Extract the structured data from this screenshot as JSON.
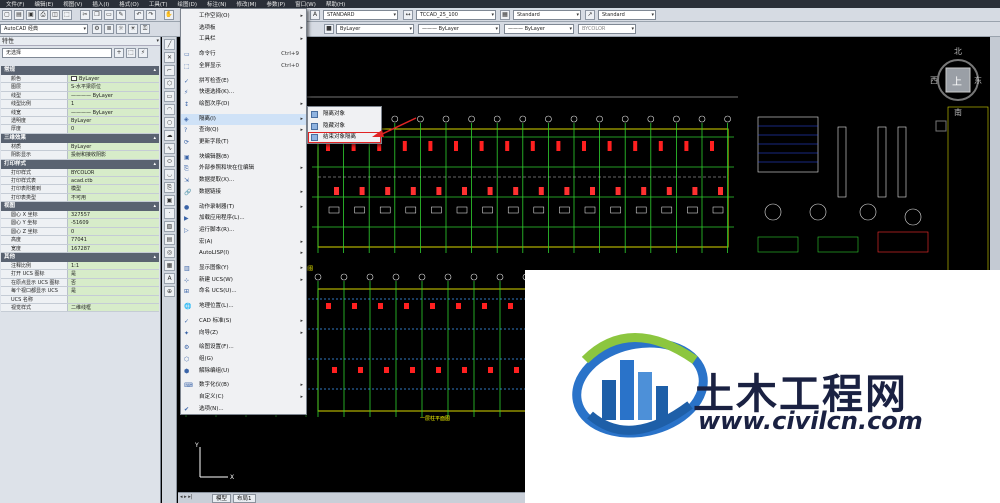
{
  "menubar": [
    "文件(F)",
    "编辑(E)",
    "视图(V)",
    "插入(I)",
    "格式(O)",
    "工具(T)",
    "绘图(D)",
    "标注(N)",
    "修改(M)",
    "参数(P)",
    "窗口(W)",
    "帮助(H)"
  ],
  "toolbar": {
    "workspace": "AutoCAD 经典",
    "text_style": "STANDARD",
    "dim_style": "TCCAD_25_100",
    "table_style": "Standard",
    "mleader_style": "Standard",
    "layer_color": "ByLayer",
    "linetype": "ByLayer",
    "lineweight": "ByLayer",
    "plot_style": "BYCOLOR"
  },
  "properties": {
    "title": "特性",
    "selection": "无选择",
    "sections": [
      {
        "name": "常规",
        "rows": [
          {
            "k": "颜色",
            "v": "ByLayer",
            "swatch": true
          },
          {
            "k": "图层",
            "v": "S-水平梁原位"
          },
          {
            "k": "线型",
            "v": "———— ByLayer"
          },
          {
            "k": "线型比例",
            "v": "1"
          },
          {
            "k": "线宽",
            "v": "———— ByLayer"
          },
          {
            "k": "透明度",
            "v": "ByLayer"
          },
          {
            "k": "厚度",
            "v": "0"
          }
        ]
      },
      {
        "name": "三维效果",
        "rows": [
          {
            "k": "材质",
            "v": "ByLayer"
          },
          {
            "k": "阴影显示",
            "v": "投射和接收阴影"
          }
        ]
      },
      {
        "name": "打印样式",
        "rows": [
          {
            "k": "打印样式",
            "v": "BYCOLOR"
          },
          {
            "k": "打印样式表",
            "v": "acad.ctb"
          },
          {
            "k": "打印表附着到",
            "v": "模型"
          },
          {
            "k": "打印表类型",
            "v": "不可用"
          }
        ]
      },
      {
        "name": "视图",
        "rows": [
          {
            "k": "圆心 X 坐标",
            "v": "327557"
          },
          {
            "k": "圆心 Y 坐标",
            "v": "-51609"
          },
          {
            "k": "圆心 Z 坐标",
            "v": "0"
          },
          {
            "k": "高度",
            "v": "77041"
          },
          {
            "k": "宽度",
            "v": "167287"
          }
        ]
      },
      {
        "name": "其他",
        "rows": [
          {
            "k": "注释比例",
            "v": "1:1"
          },
          {
            "k": "打开 UCS 图标",
            "v": "是"
          },
          {
            "k": "在原点显示 UCS 图标",
            "v": "否"
          },
          {
            "k": "每个视口都显示 UCS",
            "v": "是"
          },
          {
            "k": "UCS 名称",
            "v": ""
          },
          {
            "k": "视觉样式",
            "v": "二维线框"
          }
        ]
      }
    ]
  },
  "tools_menu": [
    {
      "label": "工作空间(O)",
      "arrow": true
    },
    {
      "label": "选项板",
      "arrow": true
    },
    {
      "label": "工具栏",
      "arrow": true
    },
    {
      "label": "命令行",
      "shortcut": "Ctrl+9"
    },
    {
      "label": "全屏显示",
      "shortcut": "Ctrl+0"
    },
    {
      "label": "拼写检查(E)"
    },
    {
      "label": "快速选择(K)..."
    },
    {
      "label": "绘图次序(D)",
      "arrow": true
    },
    {
      "label": "隔离(I)",
      "arrow": true,
      "highlight": true
    },
    {
      "label": "查询(Q)",
      "arrow": true
    },
    {
      "label": "更新字段(T)"
    },
    {
      "label": "块编辑器(B)"
    },
    {
      "label": "外部参照和块在位编辑",
      "arrow": true
    },
    {
      "label": "数据提取(X)..."
    },
    {
      "label": "数据链接",
      "arrow": true
    },
    {
      "label": "动作录制器(T)",
      "arrow": true
    },
    {
      "label": "加载应用程序(L)..."
    },
    {
      "label": "运行脚本(R)..."
    },
    {
      "label": "宏(A)",
      "arrow": true
    },
    {
      "label": "AutoLISP(I)",
      "arrow": true
    },
    {
      "label": "显示图像(Y)",
      "arrow": true
    },
    {
      "label": "新建 UCS(W)",
      "arrow": true
    },
    {
      "label": "命名 UCS(U)..."
    },
    {
      "label": "地理位置(L)..."
    },
    {
      "label": "CAD 标准(S)",
      "arrow": true
    },
    {
      "label": "向导(Z)",
      "arrow": true
    },
    {
      "label": "绘图设置(F)..."
    },
    {
      "label": "组(G)"
    },
    {
      "label": "解除编组(U)"
    },
    {
      "label": "数字化仪(B)",
      "arrow": true
    },
    {
      "label": "自定义(C)",
      "arrow": true
    },
    {
      "label": "选项(N)..."
    }
  ],
  "isolate_submenu": [
    {
      "label": "隔离对象"
    },
    {
      "label": "隐藏对象"
    },
    {
      "label": "结束对象隔离",
      "highlight": true
    }
  ],
  "viewcube": {
    "north": "北",
    "south": "南",
    "east": "东",
    "west": "西",
    "face": "上"
  },
  "tabs": [
    "模型",
    "布局1"
  ],
  "drawing_labels": [
    "一层基础平面图",
    "一层柱平面图",
    "一层梁配筋平面图"
  ],
  "watermark": {
    "cn": "土木工程网",
    "url": "www.civilcn.com"
  }
}
